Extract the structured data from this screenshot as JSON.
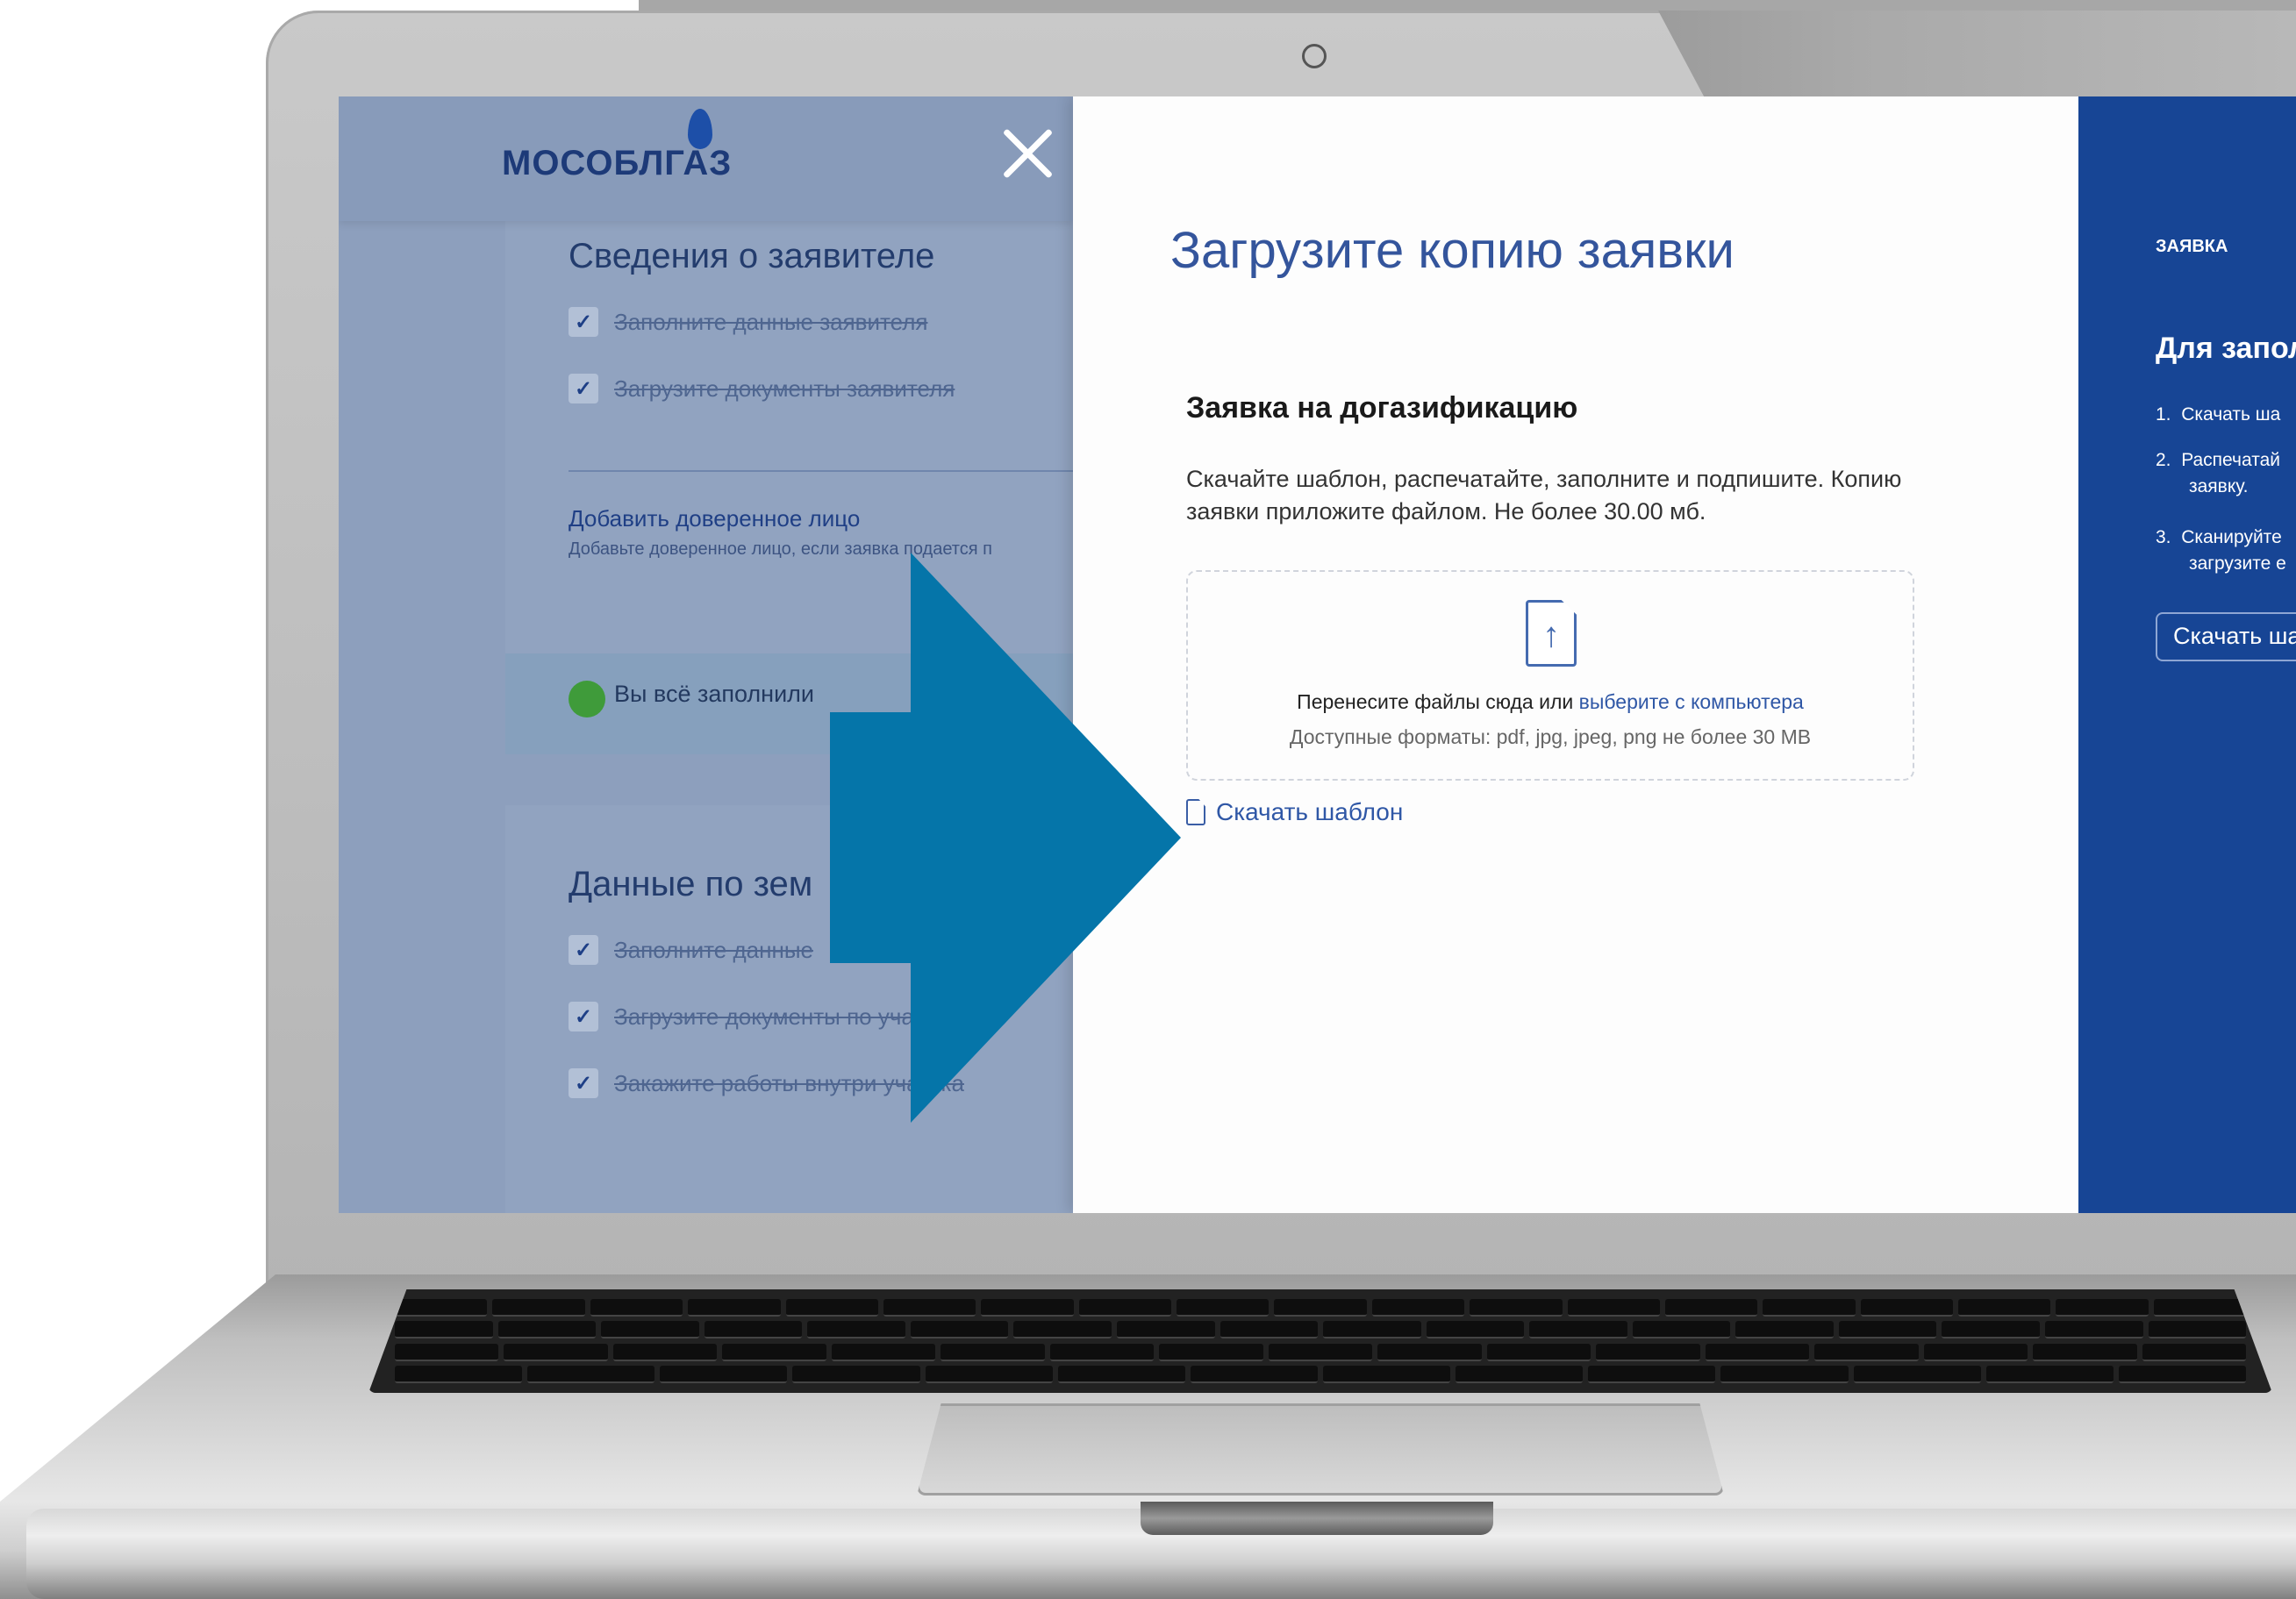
{
  "left_panel": {
    "logo": "МОСОБЛГАЗ",
    "section1_title": "Сведения о заявителе",
    "section1_items": [
      "Заполните данные заявителя",
      "Загрузите документы заявителя"
    ],
    "add_trustee_link": "Добавить доверенное лицо",
    "add_trustee_hint": "Добавьте доверенное лицо, если заявка подается п",
    "done_text": "Вы всё заполнили",
    "section2_title": "Данные по зем",
    "section2_items": [
      "Заполните данные",
      "Загрузите документы по участ",
      "Закажите работы внутри участка"
    ]
  },
  "modal": {
    "title": "Загрузите копию заявки",
    "section_title": "Заявка на догазификацию",
    "description": "Скачайте шаблон, распечатайте, заполните и подпишите. Копию заявки приложите файлом. Не более 30.00 мб.",
    "dropzone": {
      "text": "Перенесите файлы сюда или ",
      "link": "выберите с компьютера",
      "formats": "Доступные форматы: pdf, jpg, jpeg, png не более 30 MB"
    },
    "download_template": "Скачать шаблон"
  },
  "right_panel": {
    "label": "ЗАЯВКА",
    "title": "Для запол",
    "steps": [
      {
        "num": "1.",
        "lines": [
          "Скачать ша"
        ]
      },
      {
        "num": "2.",
        "lines": [
          "Распечатай",
          "заявку."
        ]
      },
      {
        "num": "3.",
        "lines": [
          "Сканируйте",
          "загрузите е"
        ]
      }
    ],
    "button": "Скачать ша"
  },
  "colors": {
    "modal_title": "#34559c",
    "right_panel_bg": "#174595",
    "arrow": "#0575a9",
    "link": "#2f57a6",
    "done_dot": "#3f9b3a"
  },
  "icons": [
    "close-icon",
    "upload-file-icon",
    "document-icon",
    "check-icon",
    "arrow-right-graphic",
    "camera-icon"
  ]
}
